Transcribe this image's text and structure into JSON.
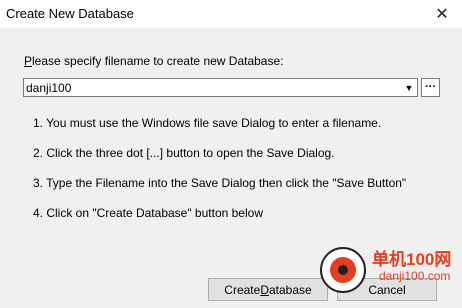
{
  "window": {
    "title": "Create New Database",
    "close_glyph": "✕"
  },
  "prompt": {
    "accel": "P",
    "rest": "lease specify filename to create new Database:"
  },
  "filename_combo": {
    "value": "danji100",
    "arrow_glyph": "▼"
  },
  "browse_button": {
    "label": "···"
  },
  "instructions": [
    "1. You must use the Windows file save Dialog to enter a filename.",
    "2. Click the three dot [...] button to open the Save Dialog.",
    "3. Type the Filename into the Save Dialog then click the \"Save Button\"",
    "4. Click on \"Create Database\" button below"
  ],
  "buttons": {
    "create": {
      "pre": "Create ",
      "accel": "D",
      "post": "atabase"
    },
    "cancel": {
      "label": "Cancel"
    }
  },
  "watermark": {
    "text": "单机100网",
    "url": "danji100.com",
    "accent": "#e53d1f"
  }
}
